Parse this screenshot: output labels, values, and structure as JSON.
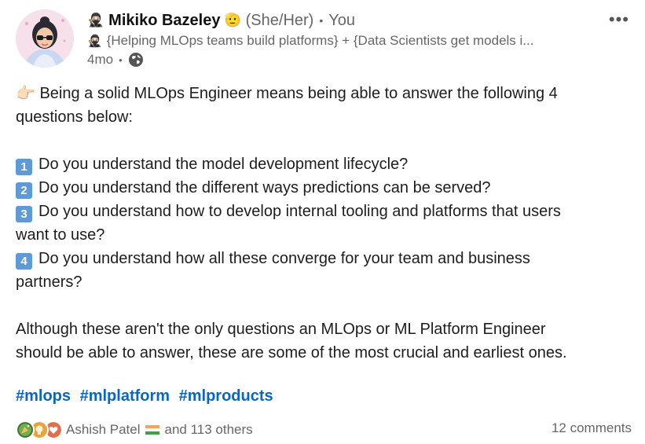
{
  "author": {
    "name_emoji": "🥷🏻",
    "name": "Mikiko Bazeley",
    "badge_emoji": "🫡",
    "pronouns": "(She/Her)",
    "separator": "•",
    "relation": "You",
    "headline_emoji": "🥷🏻",
    "headline": "{Helping MLOps teams build platforms} + {Data Scientists get models i...",
    "time": "4mo",
    "time_separator": "•",
    "visibility_icon": "globe-icon"
  },
  "more_label": "•••",
  "post": {
    "intro_emoji": "👉🏻",
    "intro_line1": "Being a solid MLOps Engineer means being able to answer the following 4",
    "intro_line2": "questions below:",
    "q1_num": "1",
    "q1": "Do you understand the model development lifecycle?",
    "q2_num": "2",
    "q2": "Do you understand the different ways predictions can be served?",
    "q3_num": "3",
    "q3_line1": "Do you understand how to develop internal tooling and platforms that users",
    "q3_line2": "want to use?",
    "q4_num": "4",
    "q4_line1": "Do you understand how all these converge for your team and business",
    "q4_line2": "partners?",
    "closing_line1": "Although these aren't the only questions an MLOps or ML Platform Engineer",
    "closing_line2": "should be able to answer, these are some of the most crucial and earliest ones."
  },
  "hashtags": [
    "#mlops",
    "#mlplatform",
    "#mlproducts"
  ],
  "social": {
    "reaction_icons": [
      "celebrate-icon",
      "insightful-icon",
      "love-icon"
    ],
    "reactor": "Ashish Patel",
    "reactor_flag": "india-flag-icon",
    "others": "and 113 others",
    "comments": "12 comments"
  },
  "colors": {
    "link": "#0a66c2",
    "secondary_text": "#666666",
    "keycap": "#5e9ad6"
  }
}
